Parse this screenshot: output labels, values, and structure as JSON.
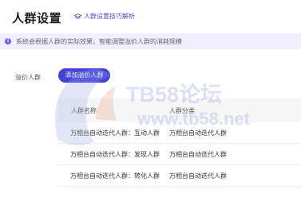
{
  "header": {
    "title": "人群设置",
    "help_link": "人群设置技巧解析"
  },
  "notice": {
    "text": "系统会根据人群的实际效果，智能调整溢价人群的消耗规模"
  },
  "premium_crowd": {
    "label": "溢价人群",
    "add_button": "添加溢价人群"
  },
  "table": {
    "columns": [
      "人群名称",
      "人群分类"
    ],
    "rows": [
      [
        "万相台自动迭代人群：互动人群",
        "万相台自动迭代人群"
      ],
      [
        "万相台自动迭代人群：发现人群",
        "万相台自动迭代人群"
      ],
      [
        "万相台自动迭代人群：转化人群",
        "万相台自动迭代人群"
      ]
    ]
  },
  "watermark": {
    "brand": "TB58论坛",
    "url": "www.tb58.net"
  },
  "colors": {
    "accent": "#4441d8",
    "notice_bg": "#efefff",
    "header_bg": "#f6f6f6"
  }
}
